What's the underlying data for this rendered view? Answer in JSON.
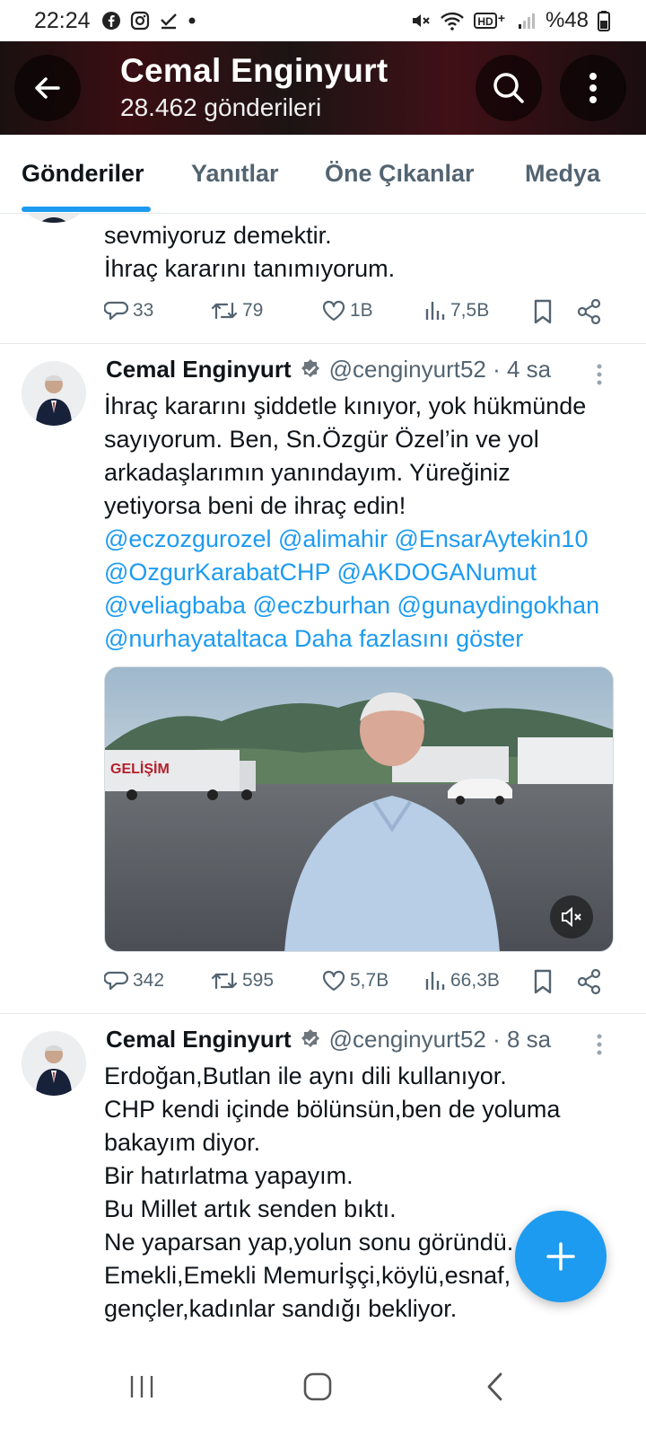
{
  "status_bar": {
    "time": "22:24",
    "battery": "%48",
    "left_icons": [
      "facebook-icon",
      "instagram-icon",
      "check-icon",
      "dot-icon"
    ],
    "right_icons": [
      "mute-icon",
      "wifi-icon",
      "hd-icon",
      "signal-icon",
      "battery-icon"
    ]
  },
  "header": {
    "title": "Cemal Enginyurt",
    "subtitle": "28.462 gönderileri"
  },
  "tabs": [
    {
      "label": "Gönderiler",
      "active": true
    },
    {
      "label": "Yanıtlar",
      "active": false
    },
    {
      "label": "Öne Çıkanlar",
      "active": false
    },
    {
      "label": "Medya",
      "active": false
    }
  ],
  "tweets": [
    {
      "lines": [
        "sevmiyoruz demektir.",
        "İhraç kararını tanımıyorum."
      ],
      "stats": {
        "replies": "33",
        "retweets": "79",
        "likes": "1B",
        "views": "7,5B"
      }
    },
    {
      "name": "Cemal Enginyurt",
      "handle": "@cenginyurt52 · 4 sa",
      "lines": [
        "İhraç kararını şiddetle kınıyor, yok hükmünde",
        "sayıyorum. Ben, Sn.Özgür Özel’in ve yol",
        "arkadaşlarımın yanındayım. Yüreğiniz",
        "yetiyorsa beni de ihraç edin!"
      ],
      "mentions": [
        "@eczozgurozel @alimahir @EnsarAytekin10",
        "@OzgurKarabatCHP @AKDOGANumut",
        "@veliagbaba @eczburhan @gunaydingokhan",
        "@nurhayataltaca"
      ],
      "show_more": "Daha fazlasını göster",
      "media_text": "GELİŞİM",
      "stats": {
        "replies": "342",
        "retweets": "595",
        "likes": "5,7B",
        "views": "66,3B"
      }
    },
    {
      "name": "Cemal Enginyurt",
      "handle": "@cenginyurt52 · 8 sa",
      "lines": [
        "Erdoğan,Butlan ile aynı dili kullanıyor.",
        "CHP kendi içinde bölünsün,ben de yoluma",
        "bakayım diyor.",
        "Bir hatırlatma yapayım.",
        "Bu Millet artık senden bıktı.",
        "Ne yaparsan yap,yolun sonu göründü.",
        "Emekli,Emekli Memurİşçi,köylü,esnaf,",
        "gençler,kadınlar sandığı bekliyor."
      ]
    }
  ],
  "colors": {
    "accent": "#1d9bf0",
    "text": "#0f1419",
    "muted": "#536471"
  }
}
